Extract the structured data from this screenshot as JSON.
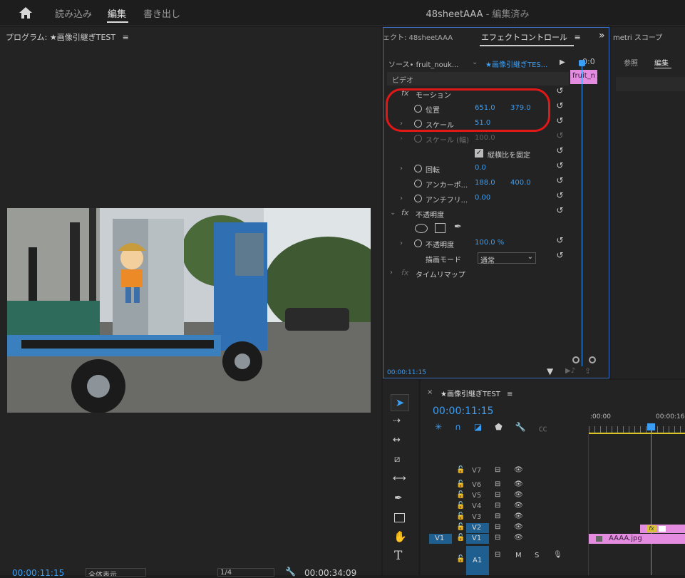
{
  "topbar": {
    "home_icon": "home-icon",
    "tabs": [
      "読み込み",
      "編集",
      "書き出し"
    ],
    "active": "編集",
    "title": "48sheetAAA",
    "title_state": "- 編集済み"
  },
  "program": {
    "title": "プログラム: ★画像引継ぎTEST",
    "timecode": "00:00:11:15",
    "fit": "全体表示",
    "quality": "1/4",
    "duration": "00:00:34:09"
  },
  "effect_controls": {
    "tab_prev": "ェクト: 48sheetAAA",
    "tab_active": "エフェクトコントロール",
    "source": "ソース• fruit_nouk...",
    "sequence": "★画像引継ぎTES...",
    "clip": "fruit_n",
    "video_label": "ビデオ",
    "playhead_time": "0:0",
    "motion": {
      "label": "モーション",
      "position": {
        "label": "位置",
        "x": "651.0",
        "y": "379.0"
      },
      "scale": {
        "label": "スケール",
        "value": "51.0"
      },
      "scale_width": {
        "label": "スケール (幅)",
        "value": "100.0"
      },
      "uniform": {
        "label": "縦横比を固定",
        "checked": true
      },
      "rotation": {
        "label": "回転",
        "value": "0.0"
      },
      "anchor": {
        "label": "アンカーポ...",
        "x": "188.0",
        "y": "400.0"
      },
      "antiflicker": {
        "label": "アンチフリ...",
        "value": "0.00"
      }
    },
    "opacity": {
      "label": "不透明度",
      "value_label": "不透明度",
      "value": "100.0 %",
      "blend_label": "描画モード",
      "blend": "通常"
    },
    "timeremap": "タイムリマップ",
    "timecode": "00:00:11:15"
  },
  "metri": {
    "title": "metri スコープ",
    "tabs": [
      "参照",
      "編集"
    ]
  },
  "timeline": {
    "title": "★画像引継ぎTEST",
    "timecode": "00:00:11:15",
    "ruler": [
      ":00:00",
      "00:00:16"
    ],
    "tracks": [
      "V7",
      "V6",
      "V5",
      "V4",
      "V3",
      "V2",
      "V1"
    ],
    "source_track": "V1",
    "audio": "A1",
    "audio_m": "M",
    "audio_s": "S",
    "clip": "AAAA.jpg",
    "fx": "fx"
  },
  "accent_color": "#3b9ef5"
}
